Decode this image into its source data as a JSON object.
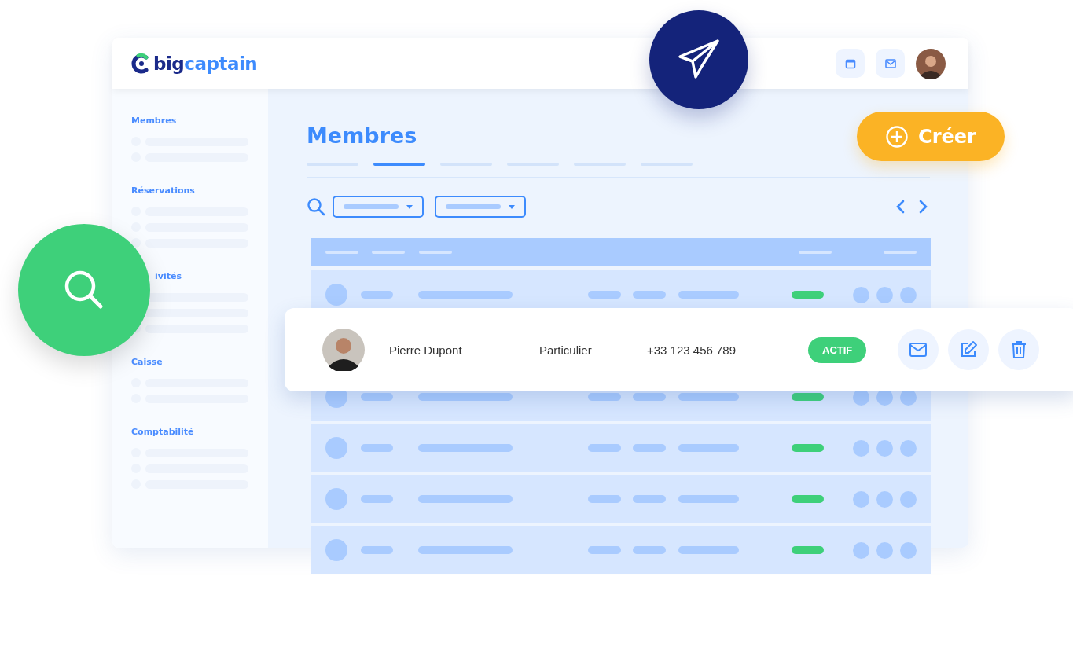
{
  "logo": {
    "primary": "big",
    "secondary": "captain"
  },
  "sidebar": {
    "sections": [
      {
        "label": "Membres"
      },
      {
        "label": "Réservations"
      },
      {
        "label": "ivités"
      },
      {
        "label": "Caisse"
      },
      {
        "label": "Comptabilité"
      }
    ]
  },
  "page": {
    "title": "Membres"
  },
  "tabs": [
    {
      "selected": false
    },
    {
      "selected": true
    },
    {
      "selected": false
    },
    {
      "selected": false
    },
    {
      "selected": false
    },
    {
      "selected": false
    }
  ],
  "create_button": {
    "label": "Créer"
  },
  "member_card": {
    "name": "Pierre Dupont",
    "type": "Particulier",
    "phone": "+33 123 456 789",
    "status": "ACTIF"
  }
}
